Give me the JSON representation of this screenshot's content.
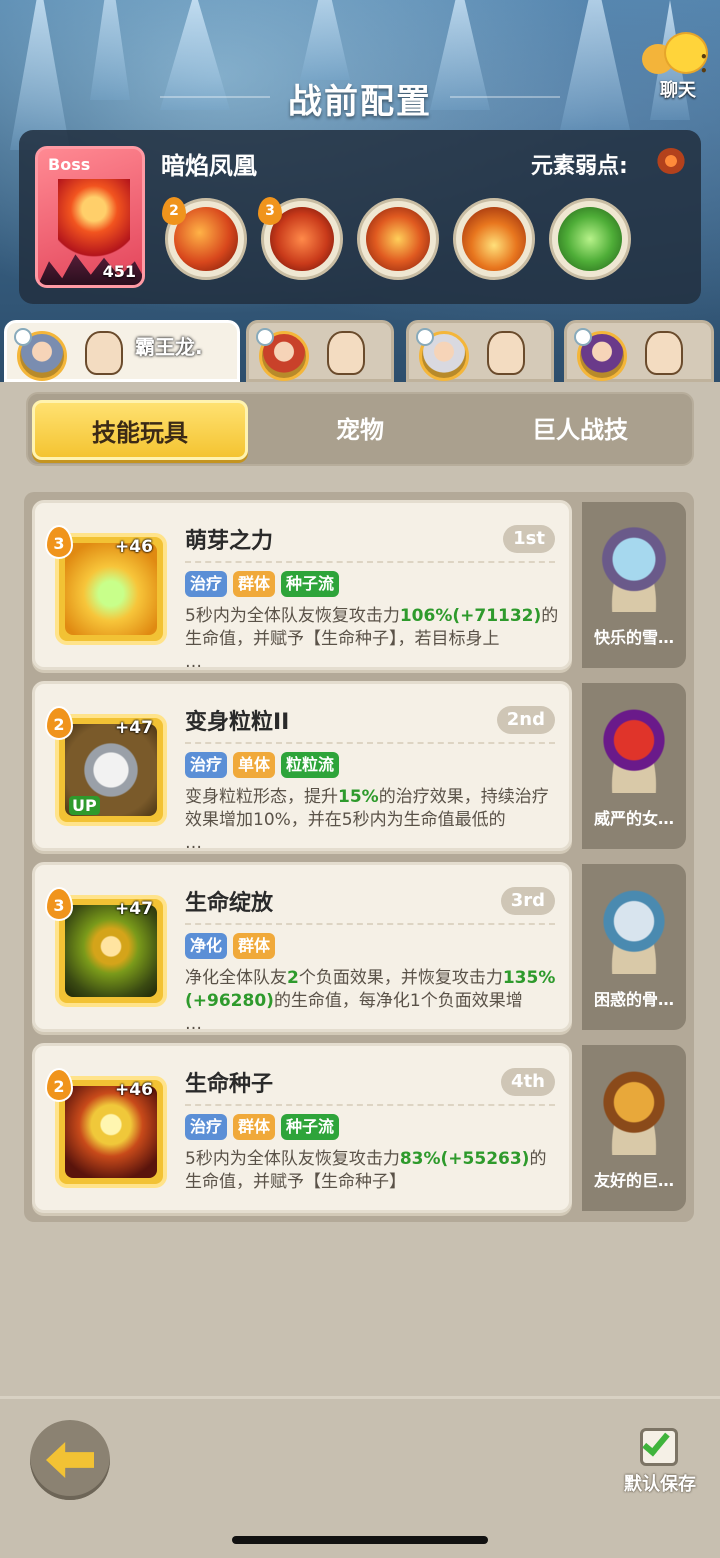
{
  "header": {
    "title": "战前配置",
    "chat_label": "聊天"
  },
  "boss": {
    "tag": "Boss",
    "name": "暗焰凤凰",
    "level": "451",
    "weakness_label": "元素弱点:",
    "skills": [
      {
        "level": "2",
        "icon": "fire-slash-icon",
        "color": "#d8471c"
      },
      {
        "level": "3",
        "icon": "fire-claw-icon",
        "color": "#c93a1a"
      },
      {
        "level": "",
        "icon": "fire-spin-icon",
        "color": "#e05a20"
      },
      {
        "level": "",
        "icon": "fire-burst-icon",
        "color": "#e8761e"
      },
      {
        "level": "",
        "icon": "poison-slime-icon",
        "color": "#4fae38"
      }
    ]
  },
  "hero_tabs": [
    {
      "name": "霸王龙.",
      "active": true
    },
    {
      "name": "",
      "active": false
    },
    {
      "name": "",
      "active": false
    },
    {
      "name": "",
      "active": false
    }
  ],
  "categories": {
    "skill_toys": "技能玩具",
    "pets": "宠物",
    "giant_skills": "巨人战技"
  },
  "skills": [
    {
      "level": "3",
      "bonus": "+46",
      "title": "萌芽之力",
      "rank": "1st",
      "tags": [
        "治疗",
        "群体",
        "种子流"
      ],
      "desc_a": "5秒内为全体队友恢复攻击力",
      "desc_hl": "106%(+71132)",
      "desc_b": "的生命值，并赋予【生命种子】，若目标身上",
      "desc_more": "…",
      "pet_name": "快乐的雪…"
    },
    {
      "level": "2",
      "bonus": "+47",
      "up": "UP",
      "title": "变身粒粒II",
      "rank": "2nd",
      "tags": [
        "治疗",
        "单体",
        "粒粒流"
      ],
      "desc_a": "变身粒粒形态，提升",
      "desc_hl": "15%",
      "desc_b": "的治疗效果，持续治疗效果增加10%，并在5秒内为生命值最低的",
      "desc_more": "…",
      "pet_name": "威严的女…"
    },
    {
      "level": "3",
      "bonus": "+47",
      "title": "生命绽放",
      "rank": "3rd",
      "tags": [
        "净化",
        "群体"
      ],
      "desc_a": "净化全体队友",
      "desc_hl": "2",
      "desc_b": "个负面效果，并恢复攻击力",
      "desc_hl2": "135%(+96280)",
      "desc_c": "的生命值，每净化1个负面效果增",
      "desc_more": "…",
      "pet_name": "困惑的骨…"
    },
    {
      "level": "2",
      "bonus": "+46",
      "title": "生命种子",
      "rank": "4th",
      "tags": [
        "治疗",
        "群体",
        "种子流"
      ],
      "desc_a": "5秒内为全体队友恢复攻击力",
      "desc_hl": "83%(+55263)",
      "desc_b": "的生命值，并赋予【生命种子】",
      "desc_more": "",
      "pet_name": "友好的巨…"
    }
  ],
  "footer": {
    "save_label": "默认保存"
  }
}
